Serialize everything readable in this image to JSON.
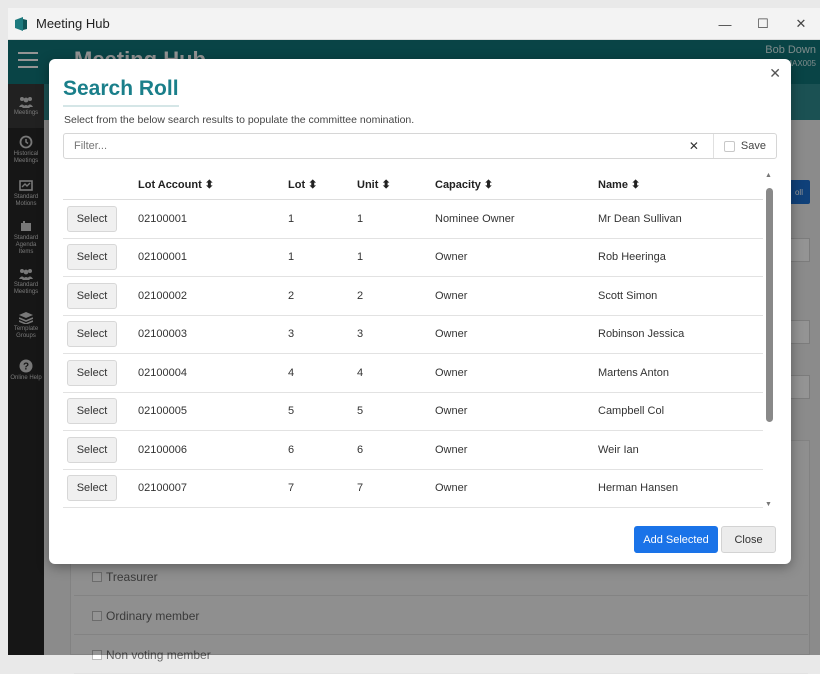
{
  "window": {
    "title": "Meeting Hub"
  },
  "app": {
    "title": "Meeting Hub",
    "user_name": "Bob Down",
    "user_sub": "MAX005"
  },
  "sidebar": {
    "items": [
      {
        "label": "Meetings",
        "icon": "meetings-icon"
      },
      {
        "label": "Historical Meetings",
        "icon": "history-icon"
      },
      {
        "label": "Standard Motions",
        "icon": "motions-icon"
      },
      {
        "label": "Standard Agenda Items",
        "icon": "agenda-icon"
      },
      {
        "label": "Standard Meetings",
        "icon": "standard-meetings-icon"
      },
      {
        "label": "Template Groups",
        "icon": "template-icon"
      },
      {
        "label": "Online Help",
        "icon": "help-icon"
      }
    ]
  },
  "background": {
    "button_label": "oll",
    "rows": [
      "Treasurer",
      "Ordinary member",
      "Non voting member"
    ]
  },
  "modal": {
    "title": "Search Roll",
    "description": "Select from the below search results to populate the committee nomination.",
    "filter_placeholder": "Filter...",
    "clear_glyph": "✕",
    "save_label": "Save",
    "close_glyph": "✕",
    "columns": [
      "",
      "Lot Account ⬍",
      "Lot ⬍",
      "Unit ⬍",
      "Capacity ⬍",
      "Name ⬍"
    ],
    "select_label": "Select",
    "rows": [
      {
        "account": "02100001",
        "lot": "1",
        "unit": "1",
        "capacity": "Nominee Owner",
        "name": "Mr Dean Sullivan"
      },
      {
        "account": "02100001",
        "lot": "1",
        "unit": "1",
        "capacity": "Owner",
        "name": "Rob Heeringa"
      },
      {
        "account": "02100002",
        "lot": "2",
        "unit": "2",
        "capacity": "Owner",
        "name": "Scott Simon"
      },
      {
        "account": "02100003",
        "lot": "3",
        "unit": "3",
        "capacity": "Owner",
        "name": "Robinson Jessica"
      },
      {
        "account": "02100004",
        "lot": "4",
        "unit": "4",
        "capacity": "Owner",
        "name": "Martens Anton"
      },
      {
        "account": "02100005",
        "lot": "5",
        "unit": "5",
        "capacity": "Owner",
        "name": "Campbell Col"
      },
      {
        "account": "02100006",
        "lot": "6",
        "unit": "6",
        "capacity": "Owner",
        "name": "Weir Ian"
      },
      {
        "account": "02100007",
        "lot": "7",
        "unit": "7",
        "capacity": "Owner",
        "name": "Herman Hansen"
      }
    ],
    "add_selected_label": "Add Selected",
    "close_label": "Close"
  },
  "colors": {
    "accent": "#107579",
    "title": "#1a7f8a",
    "primary_button": "#1a73e8"
  }
}
